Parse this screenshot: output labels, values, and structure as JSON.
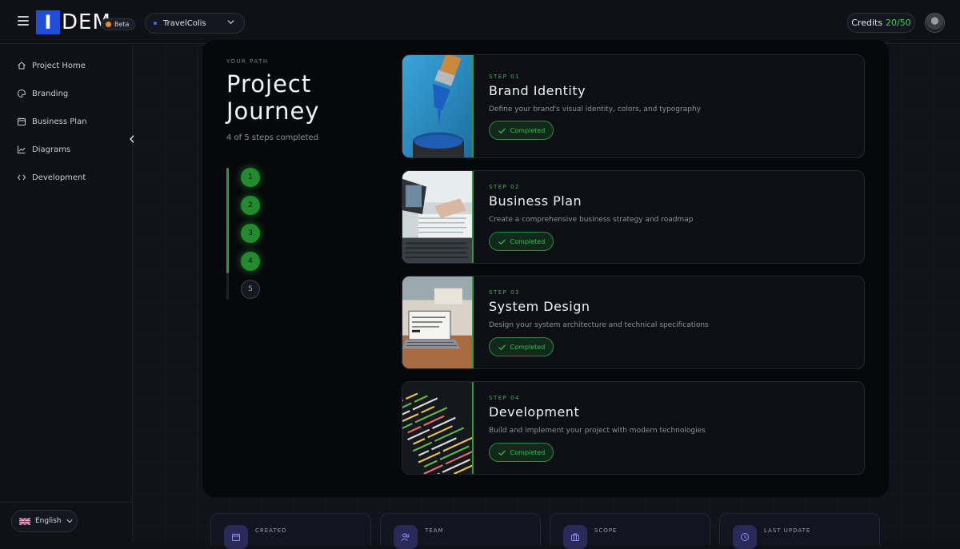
{
  "header": {
    "logo_first": "I",
    "logo_rest": "DEM",
    "beta_label": "Beta",
    "project_name": "TravelColis",
    "credits_label": "Credits",
    "credits_value": "20/50"
  },
  "sidebar": {
    "items": [
      {
        "label": "Project Home",
        "icon": "home-icon"
      },
      {
        "label": "Branding",
        "icon": "palette-icon"
      },
      {
        "label": "Business Plan",
        "icon": "calendar-icon"
      },
      {
        "label": "Diagrams",
        "icon": "chart-icon"
      },
      {
        "label": "Development",
        "icon": "code-icon"
      }
    ],
    "language": "English"
  },
  "journey": {
    "eyebrow": "YOUR PATH",
    "title": "Project Journey",
    "progress": "4 of 5 steps completed",
    "completed_steps": 4,
    "total_steps": 5,
    "step_numbers": [
      "1",
      "2",
      "3",
      "4",
      "5"
    ]
  },
  "steps": [
    {
      "label": "STEP 01",
      "title": "Brand Identity",
      "description": "Define your brand's visual identity, colors, and typography",
      "status": "Completed",
      "image": "paint-brush-photo"
    },
    {
      "label": "STEP 02",
      "title": "Business Plan",
      "description": "Create a comprehensive business strategy and roadmap",
      "status": "Completed",
      "image": "laptop-desk-photo"
    },
    {
      "label": "STEP 03",
      "title": "System Design",
      "description": "Design your system architecture and technical specifications",
      "status": "Completed",
      "image": "laptop-design-photo"
    },
    {
      "label": "STEP 04",
      "title": "Development",
      "description": "Build and implement your project with modern technologies",
      "status": "Completed",
      "image": "code-screen-photo"
    }
  ],
  "stats": [
    {
      "label": "CREATED",
      "icon": "calendar-icon"
    },
    {
      "label": "TEAM",
      "icon": "users-icon"
    },
    {
      "label": "SCOPE",
      "icon": "briefcase-icon"
    },
    {
      "label": "LAST UPDATE",
      "icon": "clock-icon"
    }
  ],
  "colors": {
    "accent_green": "#2fbf45",
    "logo_blue": "#1f4fd8",
    "background": "#0f1117"
  }
}
